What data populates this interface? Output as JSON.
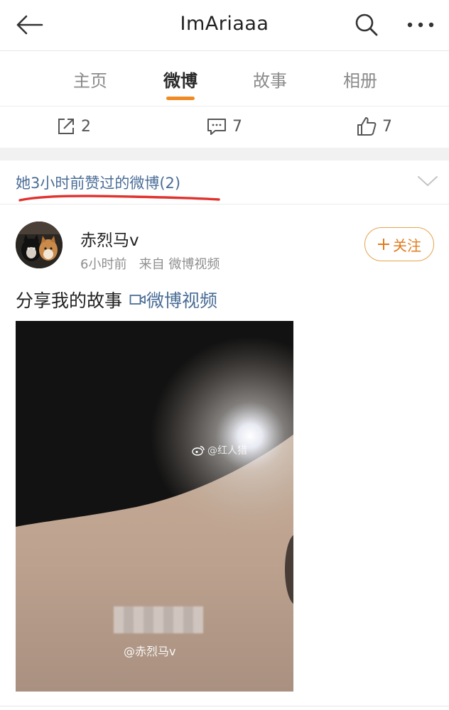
{
  "header": {
    "title": "ImAriaaa"
  },
  "tabs": [
    {
      "label": "主页",
      "active": false
    },
    {
      "label": "微博",
      "active": true
    },
    {
      "label": "故事",
      "active": false
    },
    {
      "label": "相册",
      "active": false
    }
  ],
  "stats": {
    "repost": "2",
    "comment": "7",
    "like": "7"
  },
  "liked_section": {
    "text": "她3小时前赞过的微博(2)"
  },
  "post": {
    "author": "赤烈马v",
    "time": "6小时前",
    "source": "来自 微博视频",
    "follow_label": "关注",
    "text": "分享我的故事",
    "link_label": "微博视频",
    "video": {
      "watermark_top": "@红人猎",
      "watermark_bottom": "@赤烈马v"
    }
  },
  "colors": {
    "accent_orange": "#f08a24",
    "link_blue": "#4a6d96",
    "annotation_red": "#e0322f"
  },
  "icons": [
    "back-arrow-icon",
    "search-icon",
    "more-icon",
    "repost-icon",
    "comment-icon",
    "like-icon",
    "chevron-down-icon",
    "plus-icon",
    "video-icon",
    "weibo-logo-icon"
  ]
}
